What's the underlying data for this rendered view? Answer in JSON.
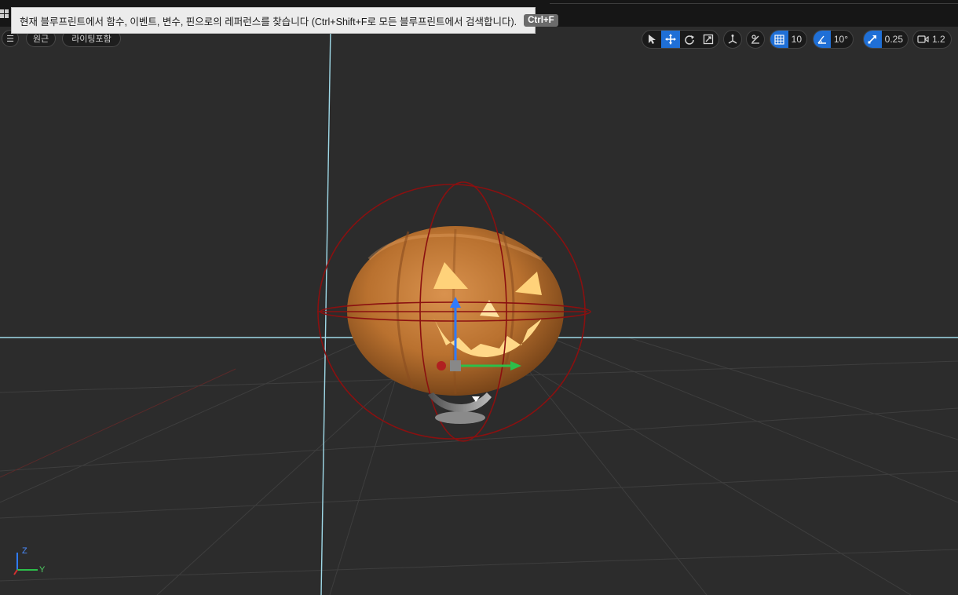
{
  "tooltip": {
    "message": "현재 블루프린트에서 함수, 이벤트, 변수, 핀으로의 레퍼런스를 찾습니다 (Ctrl+Shift+F로 모든 블루프린트에서 검색합니다).",
    "shortcut": "Ctrl+F"
  },
  "viewport_left": {
    "perspective_label": "원근",
    "view_mode_label": "라이팅포함"
  },
  "toolbar": {
    "grid_snap_value": "10",
    "rotation_snap_value": "10°",
    "scale_snap_value": "0.25",
    "camera_speed_value": "1.2"
  },
  "axes": {
    "z": "Z",
    "y": "Y"
  },
  "colors": {
    "active_blue": "#1f6fd6",
    "pumpkin": "#c47a3a",
    "bounds_red": "#8a1010",
    "axis_line": "#9fd9e8"
  },
  "icons": [
    "menu-icon",
    "select-icon",
    "translate-icon",
    "rotate-icon",
    "scale-icon",
    "world-local-icon",
    "surface-snap-icon",
    "grid-snap-icon",
    "rotation-snap-icon",
    "scale-snap-icon",
    "camera-speed-icon"
  ]
}
